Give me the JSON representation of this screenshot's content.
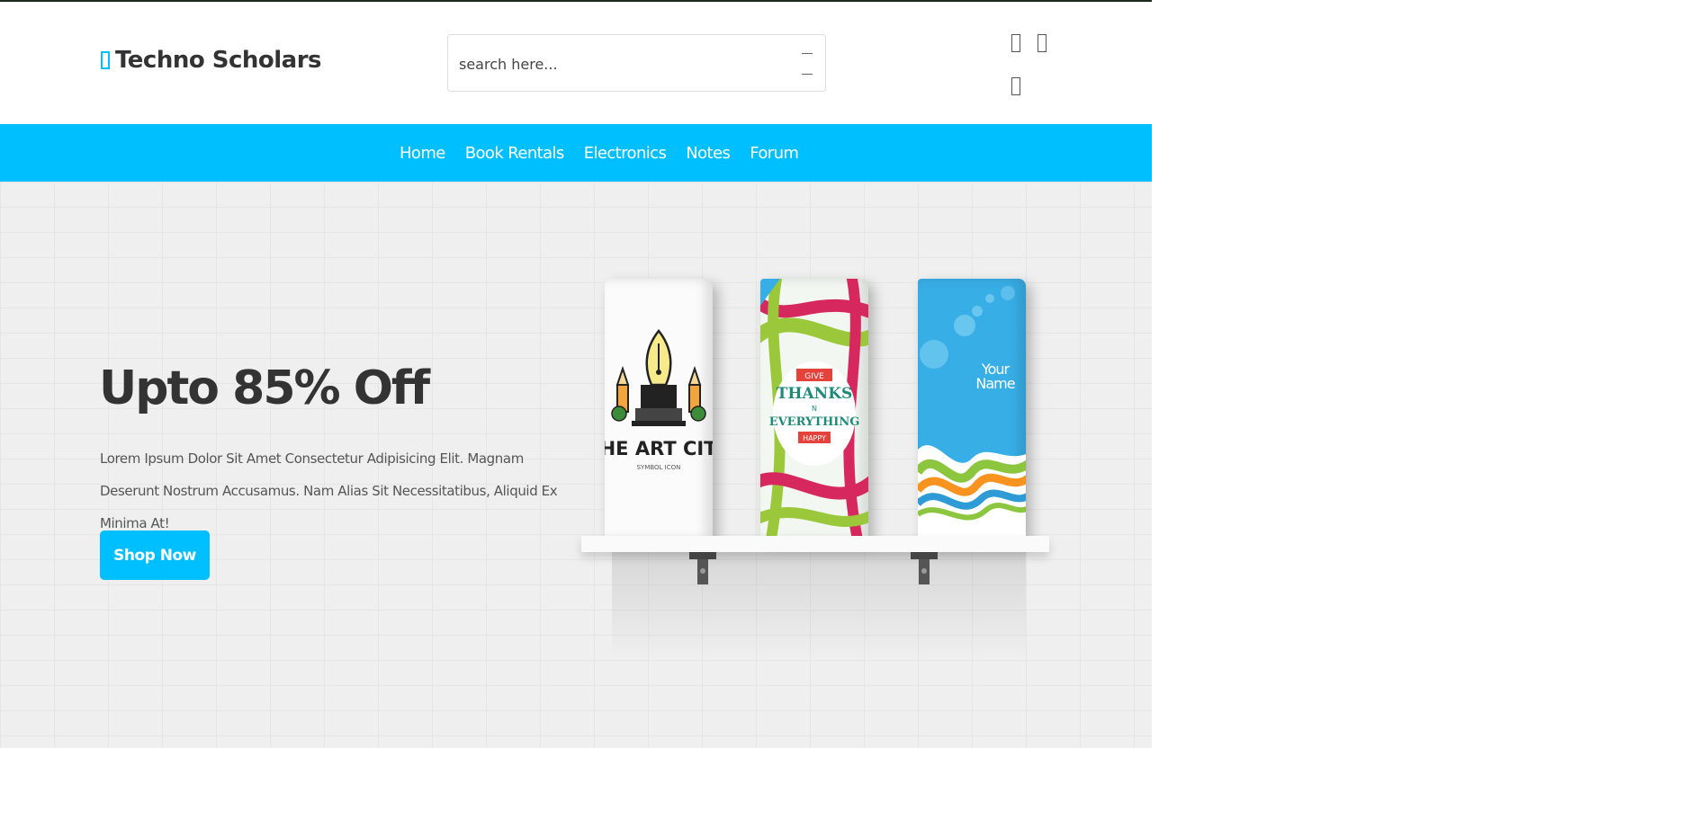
{
  "header": {
    "brand": "Techno Scholars",
    "search": {
      "placeholder": "search here..."
    }
  },
  "nav": {
    "items": [
      "Home",
      "Book Rentals",
      "Electronics",
      "Notes",
      "Forum"
    ]
  },
  "hero": {
    "title": "Upto 85% Off",
    "description": "Lorem Ipsum Dolor Sit Amet Consectetur Adipisicing Elit. Magnam Deserunt Nostrum Accusamus. Nam Alias Sit Necessitatibus, Aliquid Ex Minima At!",
    "cta_label": "Shop Now"
  },
  "illustration": {
    "book1": {
      "title": "THE ART CITY",
      "subtitle": "SYMBOL ICON"
    },
    "book2": {
      "line1": "GIVE",
      "line2": "THANKS",
      "line3": "N",
      "line4": "EVERYTHING",
      "line5": "HAPPY"
    },
    "book3": {
      "line1": "Your",
      "line2": "Name"
    }
  },
  "colors": {
    "accent": "#00bfff",
    "text_dark": "#333333"
  },
  "icons": {
    "brand": "book-icon",
    "search": "search-icon",
    "header": [
      "heart-icon",
      "cart-icon",
      "user-icon"
    ]
  }
}
